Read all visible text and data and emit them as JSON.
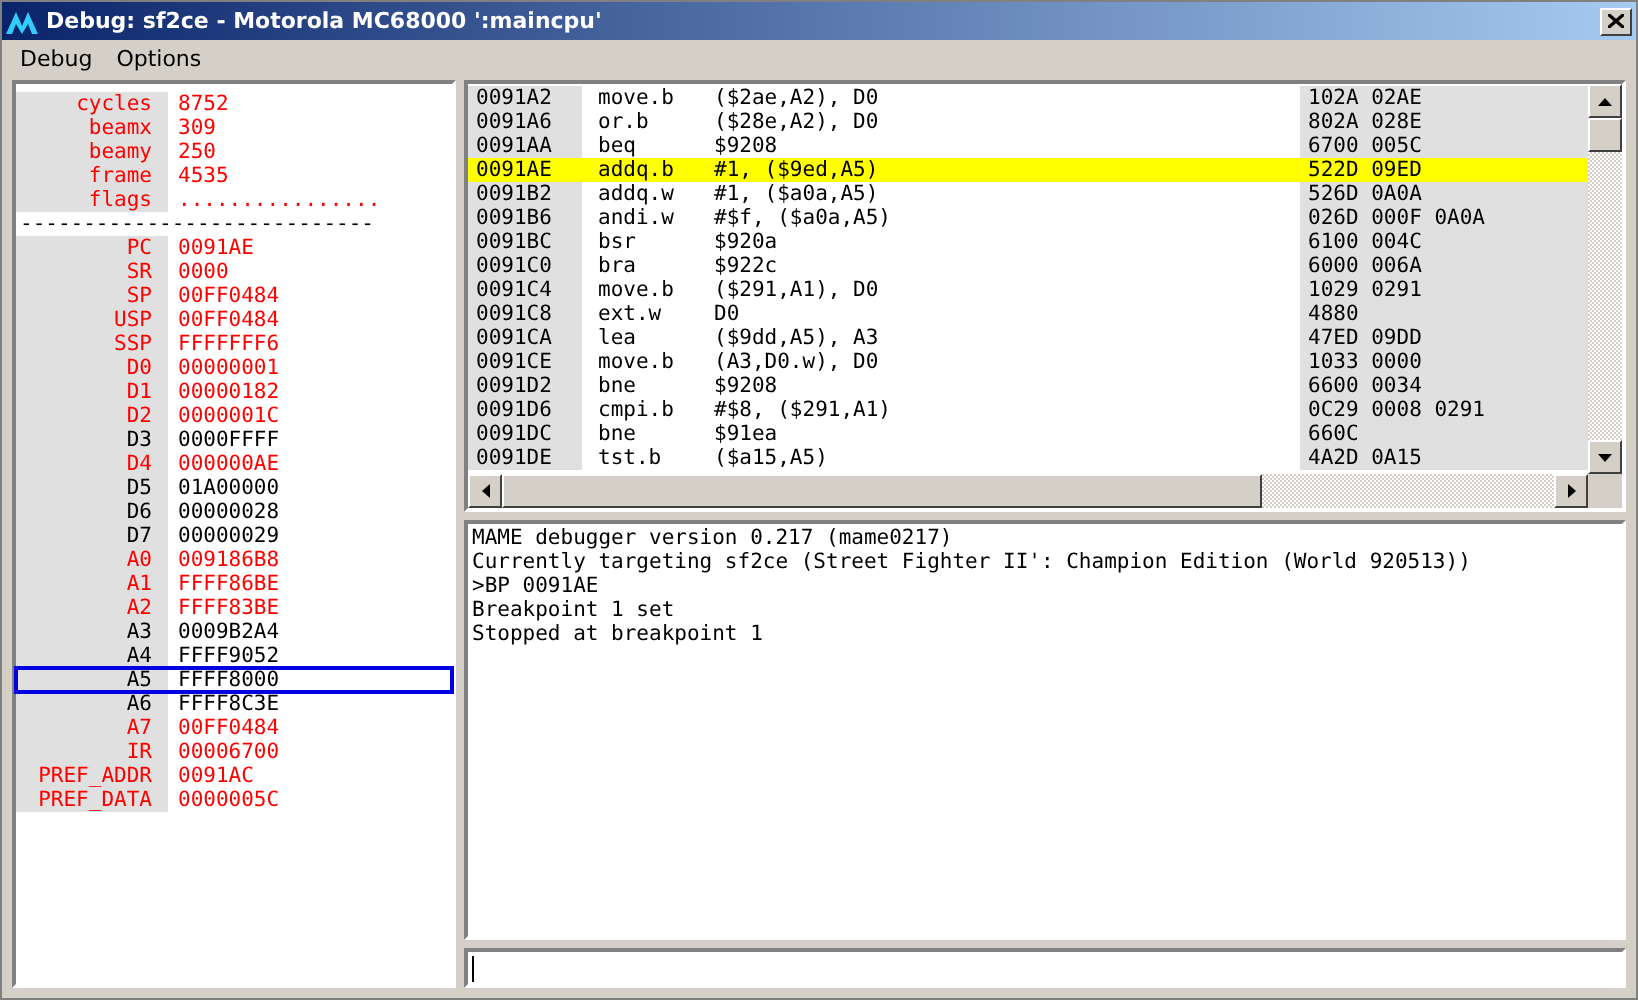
{
  "window": {
    "title": "Debug: sf2ce - Motorola MC68000 ':maincpu'"
  },
  "menu": [
    "Debug",
    "Options"
  ],
  "registers": {
    "info": [
      {
        "label": "cycles",
        "value": "8752",
        "changed": true,
        "selected": false
      },
      {
        "label": "beamx",
        "value": "309",
        "changed": true,
        "selected": false
      },
      {
        "label": "beamy",
        "value": "250",
        "changed": true,
        "selected": false
      },
      {
        "label": "frame",
        "value": "4535",
        "changed": true,
        "selected": false
      },
      {
        "label": "flags",
        "value": "................",
        "changed": true,
        "selected": false
      }
    ],
    "separator": "----------------------------",
    "regs": [
      {
        "label": "PC",
        "value": "0091AE",
        "changed": true,
        "selected": false
      },
      {
        "label": "SR",
        "value": "0000",
        "changed": true,
        "selected": false
      },
      {
        "label": "SP",
        "value": "00FF0484",
        "changed": true,
        "selected": false
      },
      {
        "label": "USP",
        "value": "00FF0484",
        "changed": true,
        "selected": false
      },
      {
        "label": "SSP",
        "value": "FFFFFFF6",
        "changed": true,
        "selected": false
      },
      {
        "label": "D0",
        "value": "00000001",
        "changed": true,
        "selected": false
      },
      {
        "label": "D1",
        "value": "00000182",
        "changed": true,
        "selected": false
      },
      {
        "label": "D2",
        "value": "0000001C",
        "changed": true,
        "selected": false
      },
      {
        "label": "D3",
        "value": "0000FFFF",
        "changed": false,
        "selected": false
      },
      {
        "label": "D4",
        "value": "000000AE",
        "changed": true,
        "selected": false
      },
      {
        "label": "D5",
        "value": "01A00000",
        "changed": false,
        "selected": false
      },
      {
        "label": "D6",
        "value": "00000028",
        "changed": false,
        "selected": false
      },
      {
        "label": "D7",
        "value": "00000029",
        "changed": false,
        "selected": false
      },
      {
        "label": "A0",
        "value": "009186B8",
        "changed": true,
        "selected": false
      },
      {
        "label": "A1",
        "value": "FFFF86BE",
        "changed": true,
        "selected": false
      },
      {
        "label": "A2",
        "value": "FFFF83BE",
        "changed": true,
        "selected": false
      },
      {
        "label": "A3",
        "value": "0009B2A4",
        "changed": false,
        "selected": false
      },
      {
        "label": "A4",
        "value": "FFFF9052",
        "changed": false,
        "selected": false
      },
      {
        "label": "A5",
        "value": "FFFF8000",
        "changed": false,
        "selected": true
      },
      {
        "label": "A6",
        "value": "FFFF8C3E",
        "changed": false,
        "selected": false
      },
      {
        "label": "A7",
        "value": "00FF0484",
        "changed": true,
        "selected": false
      },
      {
        "label": "IR",
        "value": "00006700",
        "changed": true,
        "selected": false
      },
      {
        "label": "PREF_ADDR",
        "value": "0091AC",
        "changed": true,
        "selected": false
      },
      {
        "label": "PREF_DATA",
        "value": "0000005C",
        "changed": true,
        "selected": false
      }
    ]
  },
  "disassembly": [
    {
      "address": "0091A2",
      "mnemonic": "move.b",
      "operands": "($2ae,A2), D0",
      "bytes": "102A 02AE",
      "selected": false
    },
    {
      "address": "0091A6",
      "mnemonic": "or.b",
      "operands": "($28e,A2), D0",
      "bytes": "802A 028E",
      "selected": false
    },
    {
      "address": "0091AA",
      "mnemonic": "beq",
      "operands": "$9208",
      "bytes": "6700 005C",
      "selected": false
    },
    {
      "address": "0091AE",
      "mnemonic": "addq.b",
      "operands": "#1, ($9ed,A5)",
      "bytes": "522D 09ED",
      "selected": true
    },
    {
      "address": "0091B2",
      "mnemonic": "addq.w",
      "operands": "#1, ($a0a,A5)",
      "bytes": "526D 0A0A",
      "selected": false
    },
    {
      "address": "0091B6",
      "mnemonic": "andi.w",
      "operands": "#$f, ($a0a,A5)",
      "bytes": "026D 000F 0A0A",
      "selected": false
    },
    {
      "address": "0091BC",
      "mnemonic": "bsr",
      "operands": "$920a",
      "bytes": "6100 004C",
      "selected": false
    },
    {
      "address": "0091C0",
      "mnemonic": "bra",
      "operands": "$922c",
      "bytes": "6000 006A",
      "selected": false
    },
    {
      "address": "0091C4",
      "mnemonic": "move.b",
      "operands": "($291,A1), D0",
      "bytes": "1029 0291",
      "selected": false
    },
    {
      "address": "0091C8",
      "mnemonic": "ext.w",
      "operands": "D0",
      "bytes": "4880",
      "selected": false
    },
    {
      "address": "0091CA",
      "mnemonic": "lea",
      "operands": "($9dd,A5), A3",
      "bytes": "47ED 09DD",
      "selected": false
    },
    {
      "address": "0091CE",
      "mnemonic": "move.b",
      "operands": "(A3,D0.w), D0",
      "bytes": "1033 0000",
      "selected": false
    },
    {
      "address": "0091D2",
      "mnemonic": "bne",
      "operands": "$9208",
      "bytes": "6600 0034",
      "selected": false
    },
    {
      "address": "0091D6",
      "mnemonic": "cmpi.b",
      "operands": "#$8, ($291,A1)",
      "bytes": "0C29 0008 0291",
      "selected": false
    },
    {
      "address": "0091DC",
      "mnemonic": "bne",
      "operands": "$91ea",
      "bytes": "660C",
      "selected": false
    },
    {
      "address": "0091DE",
      "mnemonic": "tst.b",
      "operands": "($a15,A5)",
      "bytes": "4A2D 0A15",
      "selected": false
    }
  ],
  "console": [
    "MAME debugger version 0.217 (mame0217)",
    "Currently targeting sf2ce (Street Fighter II': Champion Edition (World 920513))",
    ">BP 0091AE",
    "Breakpoint 1 set",
    "Stopped at breakpoint 1"
  ]
}
